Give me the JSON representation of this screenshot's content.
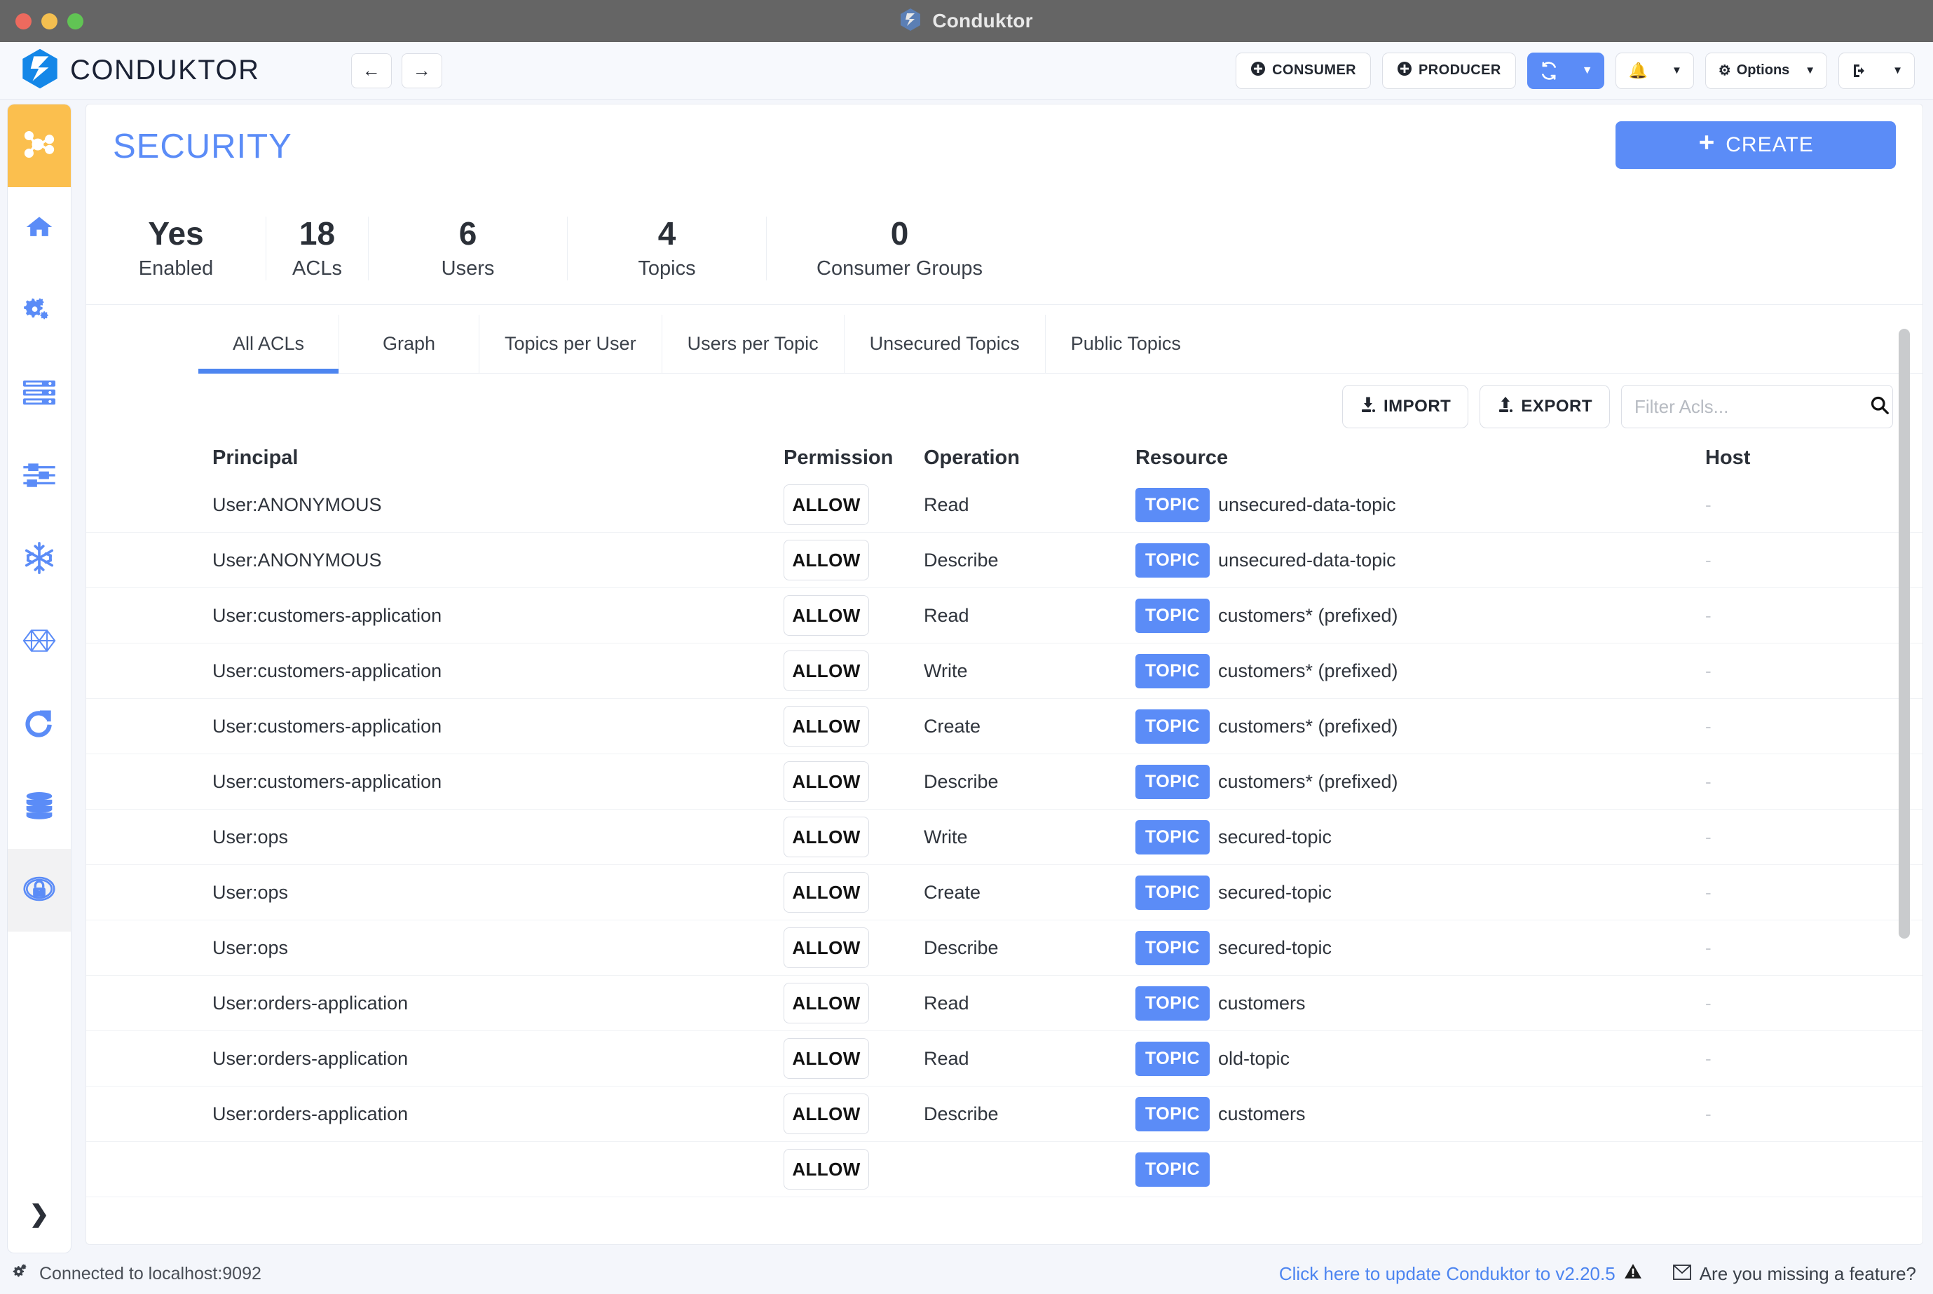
{
  "window": {
    "title": "Conduktor",
    "traffic_lights": [
      "close",
      "minimize",
      "zoom"
    ]
  },
  "appbar": {
    "brand": "CONDUKTOR",
    "nav": {
      "back": "back-arrow",
      "forward": "forward-arrow"
    },
    "buttons": [
      {
        "name": "consumer",
        "label": "CONSUMER",
        "icon": "plus-circle-icon"
      },
      {
        "name": "producer",
        "label": "PRODUCER",
        "icon": "plus-circle-icon"
      },
      {
        "name": "refresh",
        "label": "",
        "icon": "refresh-icon",
        "accent": true
      },
      {
        "name": "notifications",
        "label": "",
        "icon": "bell-icon"
      },
      {
        "name": "options",
        "label": "Options",
        "icon": "gear-icon"
      },
      {
        "name": "logout",
        "label": "",
        "icon": "exit-icon"
      }
    ]
  },
  "sidebar": {
    "items": [
      {
        "name": "kafka-cluster",
        "icon": "cluster-nodes-icon",
        "state": "active-orange"
      },
      {
        "name": "home",
        "icon": "home-icon",
        "state": "normal"
      },
      {
        "name": "brokers",
        "icon": "gears-icon",
        "state": "normal"
      },
      {
        "name": "topics",
        "icon": "server-stack-icon",
        "state": "normal"
      },
      {
        "name": "consumers",
        "icon": "sliders-icon",
        "state": "normal"
      },
      {
        "name": "ksqldb",
        "icon": "snowflake-icon",
        "state": "normal"
      },
      {
        "name": "streams",
        "icon": "polygon-graph-icon",
        "state": "normal"
      },
      {
        "name": "connect",
        "icon": "refresh-circle-icon",
        "state": "normal"
      },
      {
        "name": "schema-registry",
        "icon": "database-icon",
        "state": "normal"
      },
      {
        "name": "security",
        "icon": "lock-shield-icon",
        "state": "active-grey"
      }
    ],
    "expand": "chevron-right-icon"
  },
  "page": {
    "title": "SECURITY",
    "create_button": {
      "label": "CREATE",
      "icon": "plus-icon"
    },
    "stats": [
      {
        "value": "Yes",
        "label": "Enabled"
      },
      {
        "value": "18",
        "label": "ACLs"
      },
      {
        "value": "6",
        "label": "Users"
      },
      {
        "value": "4",
        "label": "Topics"
      },
      {
        "value": "0",
        "label": "Consumer Groups"
      }
    ],
    "tabs": [
      {
        "label": "All ACLs",
        "active": true
      },
      {
        "label": "Graph",
        "active": false
      },
      {
        "label": "Topics per User",
        "active": false
      },
      {
        "label": "Users per Topic",
        "active": false
      },
      {
        "label": "Unsecured Topics",
        "active": false
      },
      {
        "label": "Public Topics",
        "active": false
      }
    ],
    "toolbar": {
      "import_label": "IMPORT",
      "export_label": "EXPORT",
      "filter_placeholder": "Filter Acls...",
      "filter_value": "",
      "search_icon": "search-icon"
    },
    "table": {
      "columns": [
        "Principal",
        "Permission",
        "Operation",
        "Resource",
        "Host"
      ],
      "rows": [
        {
          "principal": "User:ANONYMOUS",
          "permission": "ALLOW",
          "operation": "Read",
          "resource_type": "TOPIC",
          "resource": "unsecured-data-topic",
          "host": "-"
        },
        {
          "principal": "User:ANONYMOUS",
          "permission": "ALLOW",
          "operation": "Describe",
          "resource_type": "TOPIC",
          "resource": "unsecured-data-topic",
          "host": "-"
        },
        {
          "principal": "User:customers-application",
          "permission": "ALLOW",
          "operation": "Read",
          "resource_type": "TOPIC",
          "resource": "customers* (prefixed)",
          "host": "-"
        },
        {
          "principal": "User:customers-application",
          "permission": "ALLOW",
          "operation": "Write",
          "resource_type": "TOPIC",
          "resource": "customers* (prefixed)",
          "host": "-"
        },
        {
          "principal": "User:customers-application",
          "permission": "ALLOW",
          "operation": "Create",
          "resource_type": "TOPIC",
          "resource": "customers* (prefixed)",
          "host": "-"
        },
        {
          "principal": "User:customers-application",
          "permission": "ALLOW",
          "operation": "Describe",
          "resource_type": "TOPIC",
          "resource": "customers* (prefixed)",
          "host": "-"
        },
        {
          "principal": "User:ops",
          "permission": "ALLOW",
          "operation": "Write",
          "resource_type": "TOPIC",
          "resource": "secured-topic",
          "host": "-"
        },
        {
          "principal": "User:ops",
          "permission": "ALLOW",
          "operation": "Create",
          "resource_type": "TOPIC",
          "resource": "secured-topic",
          "host": "-"
        },
        {
          "principal": "User:ops",
          "permission": "ALLOW",
          "operation": "Describe",
          "resource_type": "TOPIC",
          "resource": "secured-topic",
          "host": "-"
        },
        {
          "principal": "User:orders-application",
          "permission": "ALLOW",
          "operation": "Read",
          "resource_type": "TOPIC",
          "resource": "customers",
          "host": "-"
        },
        {
          "principal": "User:orders-application",
          "permission": "ALLOW",
          "operation": "Read",
          "resource_type": "TOPIC",
          "resource": "old-topic",
          "host": "-"
        },
        {
          "principal": "User:orders-application",
          "permission": "ALLOW",
          "operation": "Describe",
          "resource_type": "TOPIC",
          "resource": "customers",
          "host": "-"
        },
        {
          "principal": "",
          "permission": "ALLOW",
          "operation": "",
          "resource_type": "TOPIC",
          "resource": "",
          "host": ""
        }
      ]
    }
  },
  "statusbar": {
    "connection": "Connected to localhost:9092",
    "connection_icon": "gears-icon",
    "update_text": "Click here to update Conduktor to v2.20.5",
    "update_icon": "warning-icon",
    "feature_text": "Are you missing a feature?",
    "feature_icon": "envelope-icon"
  },
  "colors": {
    "accent": "#5b8cf7",
    "title_blue": "#4d85f0",
    "active_orange": "#fbbf4e",
    "titlebar": "#656565",
    "page_bg": "#f4f6fb"
  }
}
